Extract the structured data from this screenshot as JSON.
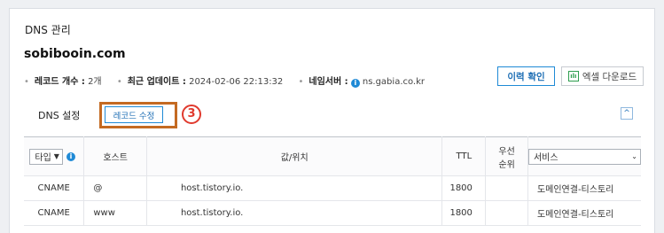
{
  "panel": {
    "title": "DNS 관리",
    "domain": "sobibooin.com"
  },
  "meta": {
    "record_count_label": "레코드 개수 :",
    "record_count_value": "2개",
    "updated_label": "최근 업데이트 :",
    "updated_value": "2024-02-06 22:13:32",
    "nameserver_label": "네임서버 :",
    "nameserver_value": "ns.gabia.co.kr"
  },
  "actions": {
    "history_label": "이력 확인",
    "excel_label": "엑셀 다운로드"
  },
  "dns_section": {
    "title": "DNS 설정",
    "edit_label": "레코드 수정",
    "step_marker": "3",
    "collapse_symbol": "^"
  },
  "table": {
    "type_filter": "타입",
    "host_header": "호스트",
    "value_header": "값/위치",
    "ttl_header": "TTL",
    "priority_header_line1": "우선",
    "priority_header_line2": "순위",
    "service_filter": "서비스",
    "rows": [
      {
        "type": "CNAME",
        "host": "@",
        "value": "host.tistory.io.",
        "ttl": "1800",
        "priority": "",
        "service": "도메인연결-티스토리"
      },
      {
        "type": "CNAME",
        "host": "www",
        "value": "host.tistory.io.",
        "ttl": "1800",
        "priority": "",
        "service": "도메인연결-티스토리"
      }
    ]
  },
  "colors": {
    "accent_blue": "#1f8ad6",
    "highlight_orange": "#c46a22",
    "step_red": "#e03a2e"
  }
}
